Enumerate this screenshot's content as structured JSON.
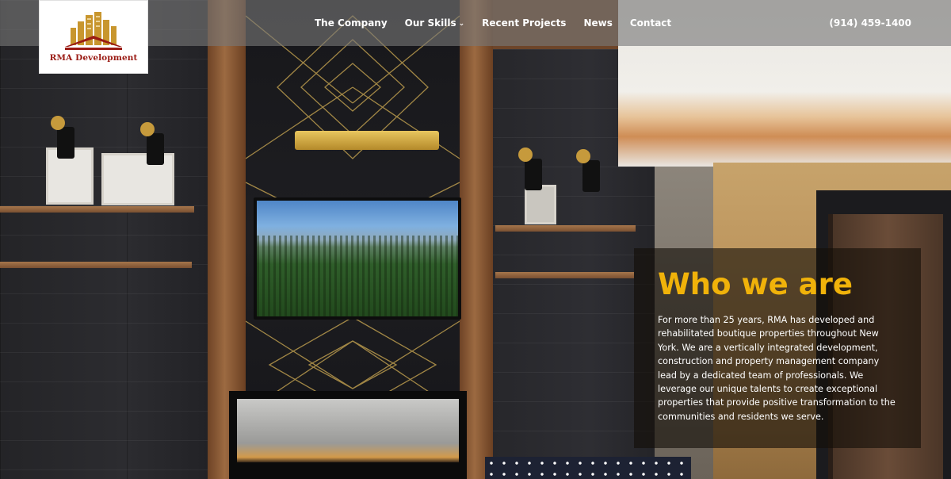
{
  "header": {
    "logo_text": "RMA Development",
    "nav": [
      {
        "label": "The Company"
      },
      {
        "label": "Our Skills",
        "has_dropdown": true
      },
      {
        "label": "Recent Projects"
      },
      {
        "label": "News"
      },
      {
        "label": "Contact"
      }
    ],
    "phone": "(914) 459-1400"
  },
  "about": {
    "title": "Who we are",
    "body": "For more than 25 years, RMA has developed and rehabilitated boutique properties throughout New York. We are a vertically integrated development, construction and property management company lead by a dedicated team of professionals. We leverage our unique talents to create exceptional properties that provide positive transformation to the communities and residents we serve."
  },
  "colors": {
    "accent": "#f0b20a",
    "logo_red": "#9a1b14",
    "logo_gold": "#c8962e",
    "header_overlay": "rgba(120,120,120,0.62)"
  },
  "icons": {
    "dropdown": "chevron-down-icon",
    "logo": "building-logo-icon"
  }
}
